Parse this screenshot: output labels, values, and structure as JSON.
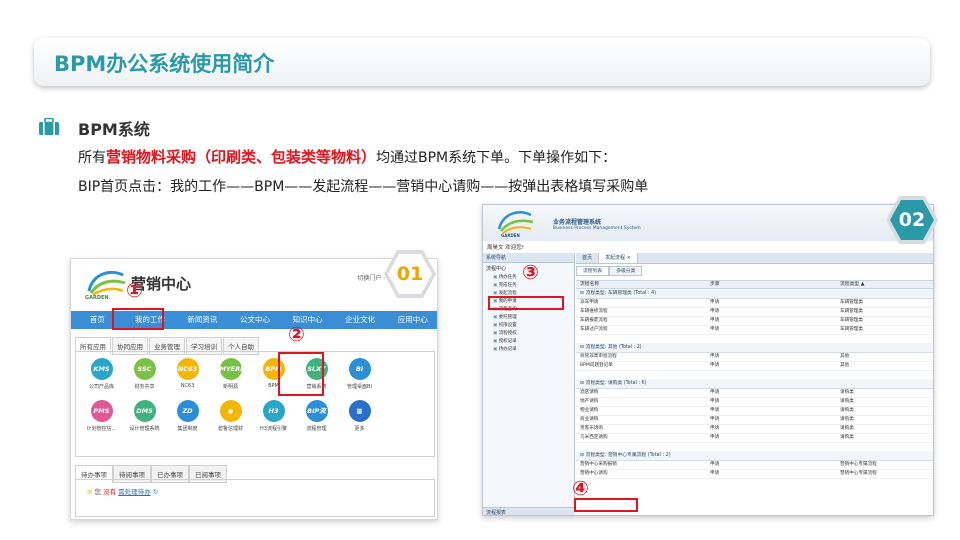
{
  "slide": {
    "title": "BPM办公系统使用简介",
    "section_title": "BPM系统",
    "line1_prefix": "所有",
    "line1_highlight": "营销物料采购（印刷类、包装类等物料）",
    "line1_suffix": "均通过BPM系统下单。下单操作如下：",
    "line2": "BIP首页点击：我的工作——BPM——发起流程——营销中心请购——按弹出表格填写采购单",
    "badge1": "01",
    "badge2": "02",
    "marker1": "①",
    "marker2": "②",
    "marker3": "③",
    "marker4": "④"
  },
  "portal": {
    "logo_text": "GARDEN",
    "title": "营销中心",
    "top_links": "切换门户 ·  欢迎您 周昊文",
    "nav": [
      "首页",
      "我的工作",
      "新闻资讯",
      "公文中心",
      "知识中心",
      "企业文化",
      "应用中心"
    ],
    "tabs": [
      "所有应用",
      "协同应用",
      "业务管理",
      "学习培训",
      "个人自助"
    ],
    "apps": [
      {
        "icon": "KMS",
        "label": "公司产品库",
        "color": "#2aa6c9"
      },
      {
        "icon": "SSC",
        "label": "财务共享",
        "color": "#7cc242"
      },
      {
        "icon": "NC63",
        "label": "NC63",
        "color": "#f2b705"
      },
      {
        "icon": "MYERP",
        "label": "新明源",
        "color": "#76c043"
      },
      {
        "icon": "BPM",
        "label": "BPM",
        "color": "#f2b705"
      },
      {
        "icon": "SLXT",
        "label": "营销系统",
        "color": "#3fb37f"
      },
      {
        "icon": "BI",
        "label": "管理桌面BI",
        "color": "#2a8fd6"
      },
      {
        "icon": "",
        "label": "",
        "color": "#ffffff"
      },
      {
        "icon": "PMS",
        "label": "计划管控信...",
        "color": "#e0579a"
      },
      {
        "icon": "DMS",
        "label": "设计管理系统",
        "color": "#3fb37f"
      },
      {
        "icon": "ZD",
        "label": "集团制度",
        "color": "#2a8fd6"
      },
      {
        "icon": "◉",
        "label": "碧鲁信理财",
        "color": "#f2b705"
      },
      {
        "icon": "H3",
        "label": "H3流程引擎",
        "color": "#2aa6c9"
      },
      {
        "icon": "BIP流程",
        "label": "流程管理",
        "color": "#2a8fd6"
      },
      {
        "icon": "▦",
        "label": "更多",
        "color": "#2a6fc9"
      }
    ],
    "bottom_tabs": [
      "待办事项",
      "待阅事项",
      "已办事项",
      "已阅事项"
    ],
    "notice_prefix": "您",
    "notice_warn": "没有",
    "notice_link": "需处理待办"
  },
  "bpm": {
    "system_name": "业务流程管理系统",
    "system_name_en": "Business Process Management System",
    "logo_text": "GARDEN",
    "welcome": "周昊文 欢迎您!",
    "side_head": "系统导航",
    "side_sub": "流程中心",
    "tree": [
      "待办任务",
      "完成任务",
      "发起流程",
      "我的申请",
      "流程查询",
      "委托管理",
      "权限设置",
      "流程授权",
      "授权记录",
      "待办记录"
    ],
    "side_foot": "流程报表",
    "tabs": [
      "首页",
      "发起流程 ×"
    ],
    "subtabs": [
      "流程列表",
      "多级分类"
    ],
    "columns": [
      "流程名称",
      "步骤",
      "流程类型 ▲"
    ],
    "groups": [
      {
        "title": "⊟ 流程类型: 车辆管理类 (Total : 4)",
        "rows": [
          [
            "派车申请",
            "申请",
            "车辆管理类"
          ],
          [
            "车辆维修流程",
            "申请",
            "车辆管理类"
          ],
          [
            "车辆报废流程",
            "申请",
            "车辆管理类"
          ],
          [
            "车辆过户流程",
            "申请",
            "车辆管理类"
          ]
        ]
      },
      {
        "title": "⊟ 流程类型: 其他 (Total : 2)",
        "rows": [
          [
            "商管非周审批流程",
            "申请",
            "其他"
          ],
          [
            "BPM问题登记单",
            "申请",
            "其他"
          ]
        ]
      },
      {
        "title": "⊟ 流程类型: 请购类 (Total : 6)",
        "rows": [
          [
            "酒店请购",
            "申请",
            "请购类"
          ],
          [
            "地产请购",
            "申请",
            "请购类"
          ],
          [
            "物业请购",
            "申请",
            "请购类"
          ],
          [
            "商业请购",
            "申请",
            "请购类"
          ],
          [
            "贵客乐请购",
            "申请",
            "请购类"
          ],
          [
            "乌米西定请购",
            "申请",
            "请购类"
          ]
        ]
      },
      {
        "title": "⊟ 流程类型: 营销中心专属流程 (Total : 2)",
        "rows": [
          [
            "营销中心采购报销",
            "申请",
            "营销中心专属流程"
          ],
          [
            "营销中心请购",
            "申请",
            "营销中心专属流程"
          ]
        ]
      }
    ]
  }
}
